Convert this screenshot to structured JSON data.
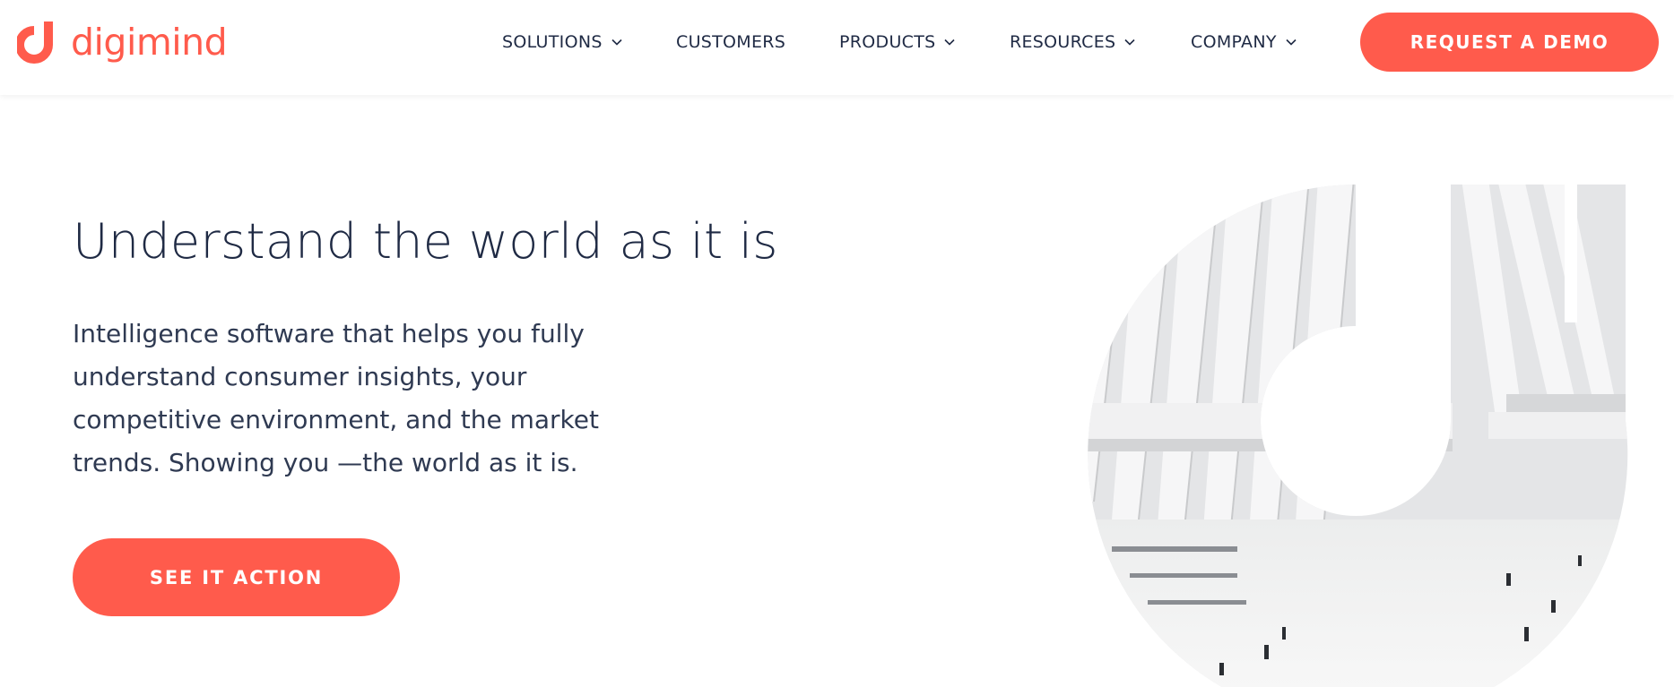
{
  "brand": {
    "name": "digimind",
    "color": "#ff5b4c"
  },
  "nav": {
    "items": [
      {
        "label": "SOLUTIONS",
        "has_dropdown": true
      },
      {
        "label": "CUSTOMERS",
        "has_dropdown": false
      },
      {
        "label": "PRODUCTS",
        "has_dropdown": true
      },
      {
        "label": "RESOURCES",
        "has_dropdown": true
      },
      {
        "label": "COMPANY",
        "has_dropdown": true
      }
    ],
    "cta_label": "REQUEST A DEMO"
  },
  "hero": {
    "title": "Understand the world as it is",
    "description": "Intelligence software that helps you fully understand consumer insights, your competitive environment, and the market trends. Showing you —the world as it is.",
    "cta_label": "SEE IT ACTION",
    "image_icon": "architecture-photo-in-logo-shape"
  },
  "colors": {
    "accent": "#ff5b4c",
    "text": "#1f2a44"
  }
}
